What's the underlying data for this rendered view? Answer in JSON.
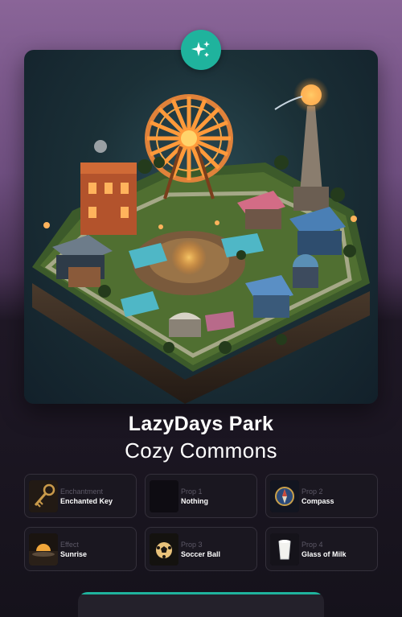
{
  "title": "LazyDays Park",
  "subtitle": "Cozy Commons",
  "badge_icon": "sparkles-icon",
  "colors": {
    "accent": "#1fb39d",
    "background_top": "#8a6598",
    "background_bottom": "#15121b",
    "panel": "#1a1720",
    "muted_text": "#5c5866"
  },
  "traits": [
    {
      "category": "Enchantment",
      "value": "Enchanted Key",
      "icon": "key-icon"
    },
    {
      "category": "Prop 1",
      "value": "Nothing",
      "icon": "empty-icon"
    },
    {
      "category": "Prop 2",
      "value": "Compass",
      "icon": "compass-icon"
    },
    {
      "category": "Effect",
      "value": "Sunrise",
      "icon": "sunrise-icon"
    },
    {
      "category": "Prop 3",
      "value": "Soccer Ball",
      "icon": "soccer-ball-icon"
    },
    {
      "category": "Prop 4",
      "value": "Glass of Milk",
      "icon": "milk-glass-icon"
    }
  ]
}
